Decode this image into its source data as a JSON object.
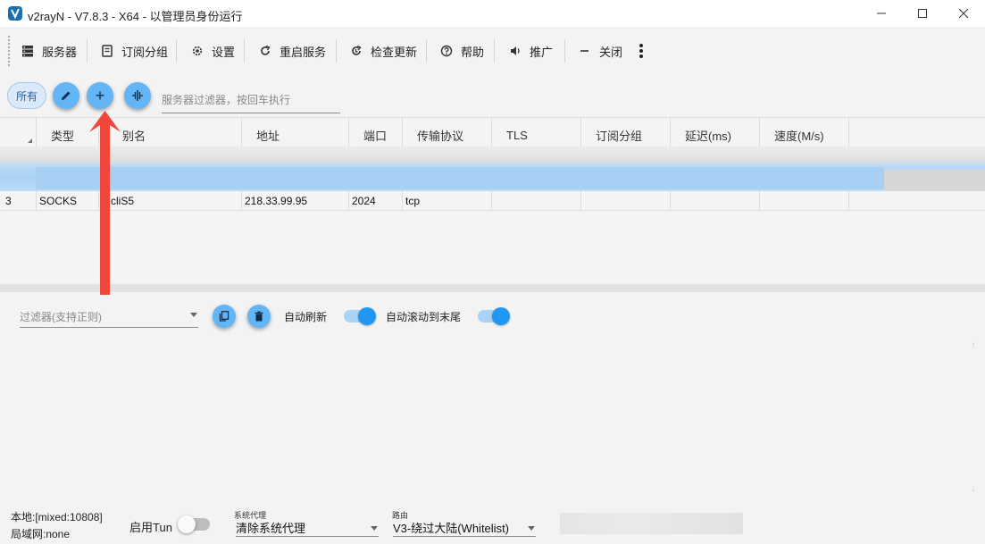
{
  "window": {
    "title": "v2rayN - V7.8.3 - X64 - 以管理员身份运行",
    "minimize": "—",
    "maximize": "☐",
    "close": "✕"
  },
  "toolbar": {
    "items": [
      {
        "label": "服务器",
        "icon": "server-icon"
      },
      {
        "label": "订阅分组",
        "icon": "subscription-icon"
      },
      {
        "label": "设置",
        "icon": "gear-icon"
      },
      {
        "label": "重启服务",
        "icon": "restart-icon"
      },
      {
        "label": "检查更新",
        "icon": "update-icon"
      },
      {
        "label": "帮助",
        "icon": "help-icon"
      },
      {
        "label": "推广",
        "icon": "speaker-icon"
      },
      {
        "label": "关闭",
        "icon": "minus-icon"
      }
    ],
    "more_icon": "more-vertical-icon"
  },
  "filter_bar": {
    "all_chip": "所有",
    "edit_icon": "pencil-icon",
    "add_label": "+",
    "split_icon": "split-icon",
    "filter_placeholder": "服务器过滤器，按回车执行"
  },
  "table": {
    "columns": [
      "类型",
      "别名",
      "地址",
      "端口",
      "传输协议",
      "TLS",
      "订阅分组",
      "延迟(ms)",
      "速度(M/s)"
    ],
    "rows": [
      {
        "index": "3",
        "type": "SOCKS",
        "alias": "cliS5",
        "address": "218.33.99.95",
        "port": "2024",
        "network": "tcp",
        "tls": "",
        "sub": "",
        "delay": "",
        "speed": ""
      }
    ]
  },
  "log_panel": {
    "filter_placeholder": "过滤器(支持正则)",
    "copy_icon": "copy-icon",
    "delete_icon": "trash-icon",
    "auto_refresh_label": "自动刷新",
    "auto_refresh": true,
    "auto_scroll_label": "自动滚动到末尾",
    "auto_scroll": true
  },
  "status_bar": {
    "local": "本地:[mixed:10808]",
    "lan": "局域网:none",
    "tun_label": "启用Tun",
    "tun_enabled": false,
    "system_proxy_caption": "系统代理",
    "system_proxy_value": "清除系统代理",
    "routing_caption": "路由",
    "routing_value": "V3-绕过大陆(Whitelist)"
  },
  "colors": {
    "accent": "#2196f3",
    "fab": "#64b5f6",
    "selection": "#a8d0f4",
    "annotation": "#f0463c"
  }
}
